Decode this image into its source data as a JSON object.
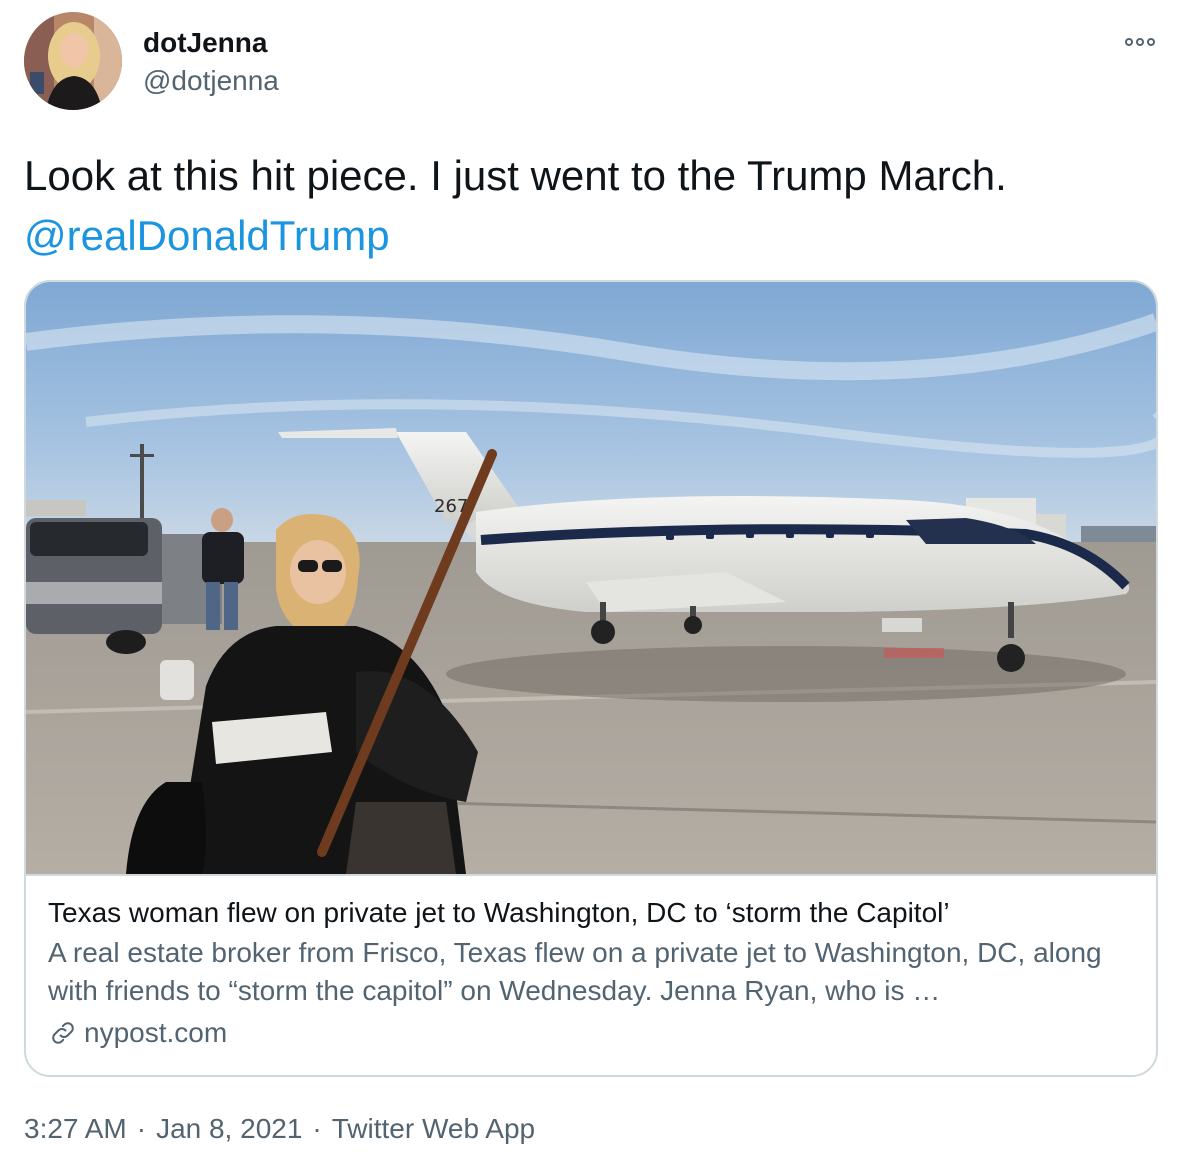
{
  "tweet": {
    "display_name": "dotJenna",
    "handle": "@dotjenna",
    "text_line1": "Look at this hit piece. I just went to the Trump March.",
    "mention": "@realDonaldTrump",
    "more_icon": "more-horizontal-icon"
  },
  "card": {
    "title": "Texas woman flew on private jet to Washington, DC to ‘storm the Capitol’",
    "description": "A real estate broker from Frisco, Texas flew on a private jet to Washington, DC, along with friends to “storm the capitol” on Wednesday. Jenna Ryan, who is …",
    "domain": "nypost.com",
    "link_icon": "link-icon",
    "tail_number": "267"
  },
  "footer": {
    "time": "3:27 AM",
    "separator": "·",
    "date": "Jan 8, 2021",
    "client": "Twitter Web App"
  },
  "colors": {
    "link": "#1b95e0",
    "text": "#0f1419",
    "secondary": "#536471",
    "border": "#cfd9de"
  }
}
